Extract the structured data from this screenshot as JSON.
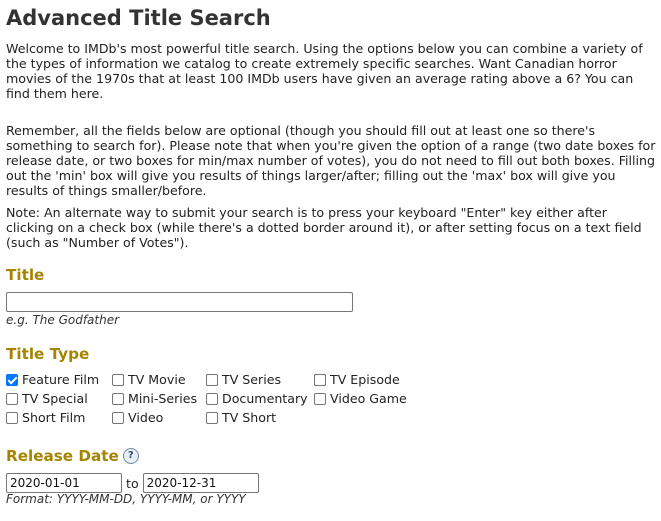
{
  "page_title": "Advanced Title Search",
  "intro": "Welcome to IMDb's most powerful title search. Using the options below you can combine a variety of the types of information we catalog to create extremely specific searches. Want Canadian horror movies of the 1970s that at least 100 IMDb users have given an average rating above a 6? You can find them here.",
  "remember": "Remember, all the fields below are optional (though you should fill out at least one so there's something to search for). Please note that when you're given the option of a range (two date boxes for release date, or two boxes for min/max number of votes), you do not need to fill out both boxes. Filling out the 'min' box will give you results of things larger/after; filling out the 'max' box will give you results of things smaller/before.",
  "note": "Note: An alternate way to submit your search is to press your keyboard \"Enter\" key either after clicking on a check box (while there's a dotted border around it), or after setting focus on a text field (such as \"Number of Votes\").",
  "title_section": {
    "heading": "Title",
    "value": "",
    "example": "e.g. The Godfather"
  },
  "title_type_section": {
    "heading": "Title Type",
    "options": [
      {
        "label": "Feature Film",
        "checked": true
      },
      {
        "label": "TV Movie",
        "checked": false
      },
      {
        "label": "TV Series",
        "checked": false
      },
      {
        "label": "TV Episode",
        "checked": false
      },
      {
        "label": "TV Special",
        "checked": false
      },
      {
        "label": "Mini-Series",
        "checked": false
      },
      {
        "label": "Documentary",
        "checked": false
      },
      {
        "label": "Video Game",
        "checked": false
      },
      {
        "label": "Short Film",
        "checked": false
      },
      {
        "label": "Video",
        "checked": false
      },
      {
        "label": "TV Short",
        "checked": false
      }
    ]
  },
  "release_date_section": {
    "heading": "Release Date",
    "help_icon": "?",
    "min_value": "2020-01-01",
    "separator": "to",
    "max_value": "2020-12-31",
    "format_note": "Format: YYYY-MM-DD, YYYY-MM, or YYYY"
  },
  "colors": {
    "heading": "#a58500",
    "checkbox_checked": "#0075ff"
  }
}
